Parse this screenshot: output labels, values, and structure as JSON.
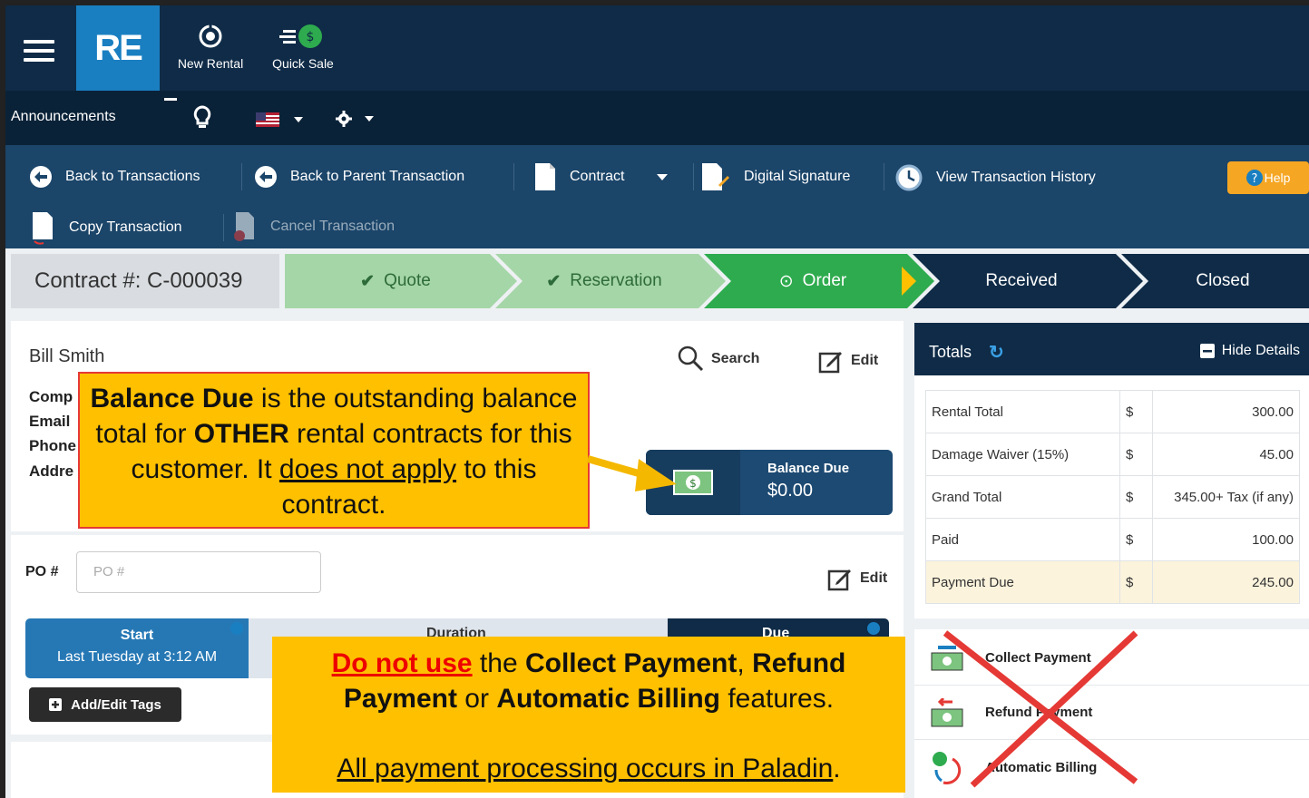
{
  "topbar": {
    "logo": "RE",
    "new_rental": "New Rental",
    "quick_sale": "Quick Sale"
  },
  "annbar": {
    "announcements": "Announcements"
  },
  "actions": {
    "back_transactions": "Back to Transactions",
    "back_parent": "Back to Parent Transaction",
    "contract": "Contract",
    "digital_signature": "Digital Signature",
    "view_history": "View Transaction History",
    "help": "Help",
    "copy_transaction": "Copy Transaction",
    "cancel_transaction": "Cancel Transaction"
  },
  "progress": {
    "contract_no": "Contract #: C-000039",
    "steps": [
      "Quote",
      "Reservation",
      "Order",
      "Received",
      "Closed"
    ]
  },
  "customer": {
    "name": "Bill Smith",
    "labels": [
      "Comp",
      "Email",
      "Phone",
      "Addre"
    ],
    "search": "Search",
    "edit": "Edit",
    "balance_label": "Balance Due",
    "balance_value": "$0.00"
  },
  "po": {
    "label": "PO #",
    "placeholder": "PO #",
    "edit": "Edit"
  },
  "timeline": {
    "start_label": "Start",
    "start_value": "Last Tuesday at 3:12 AM",
    "duration_label": "Duration",
    "due_label": "Due"
  },
  "tags_button": "Add/Edit Tags",
  "totals": {
    "title": "Totals",
    "hide_details": "Hide Details",
    "rows": [
      {
        "label": "Rental Total",
        "cur": "$",
        "value": "300.00"
      },
      {
        "label": "Damage Waiver (15%)",
        "cur": "$",
        "value": "45.00"
      },
      {
        "label": "Grand Total",
        "cur": "$",
        "value": "345.00+ Tax (if any)"
      },
      {
        "label": "Paid",
        "cur": "$",
        "value": "100.00"
      },
      {
        "label": "Payment Due",
        "cur": "$",
        "value": "245.00"
      }
    ]
  },
  "payments": {
    "collect": "Collect Payment",
    "refund": "Refund Payment",
    "auto": "Automatic Billing"
  },
  "callout1": {
    "b1": "Balance Due",
    "t1": " is the outstanding balance total for ",
    "b2": "OTHER",
    "t2": " rental contracts for this customer. It ",
    "u1": "does not apply",
    "t3": " to this contract."
  },
  "callout2": {
    "u1": "Do not use",
    "t1": " the ",
    "b1": "Collect Payment",
    "t2": ", ",
    "b2": "Refund Payment",
    "t3": " or ",
    "b3": "Automatic Billing",
    "t4": " features.",
    "line2": "All payment processing occurs in Paladin",
    "dot": "."
  },
  "colors": {
    "navy": "#0f2b47",
    "blue": "#1b4569",
    "quote_green": "#a5d6a7",
    "order_green": "#2eab4e",
    "callout": "#ffc000",
    "help": "#f5a623"
  }
}
